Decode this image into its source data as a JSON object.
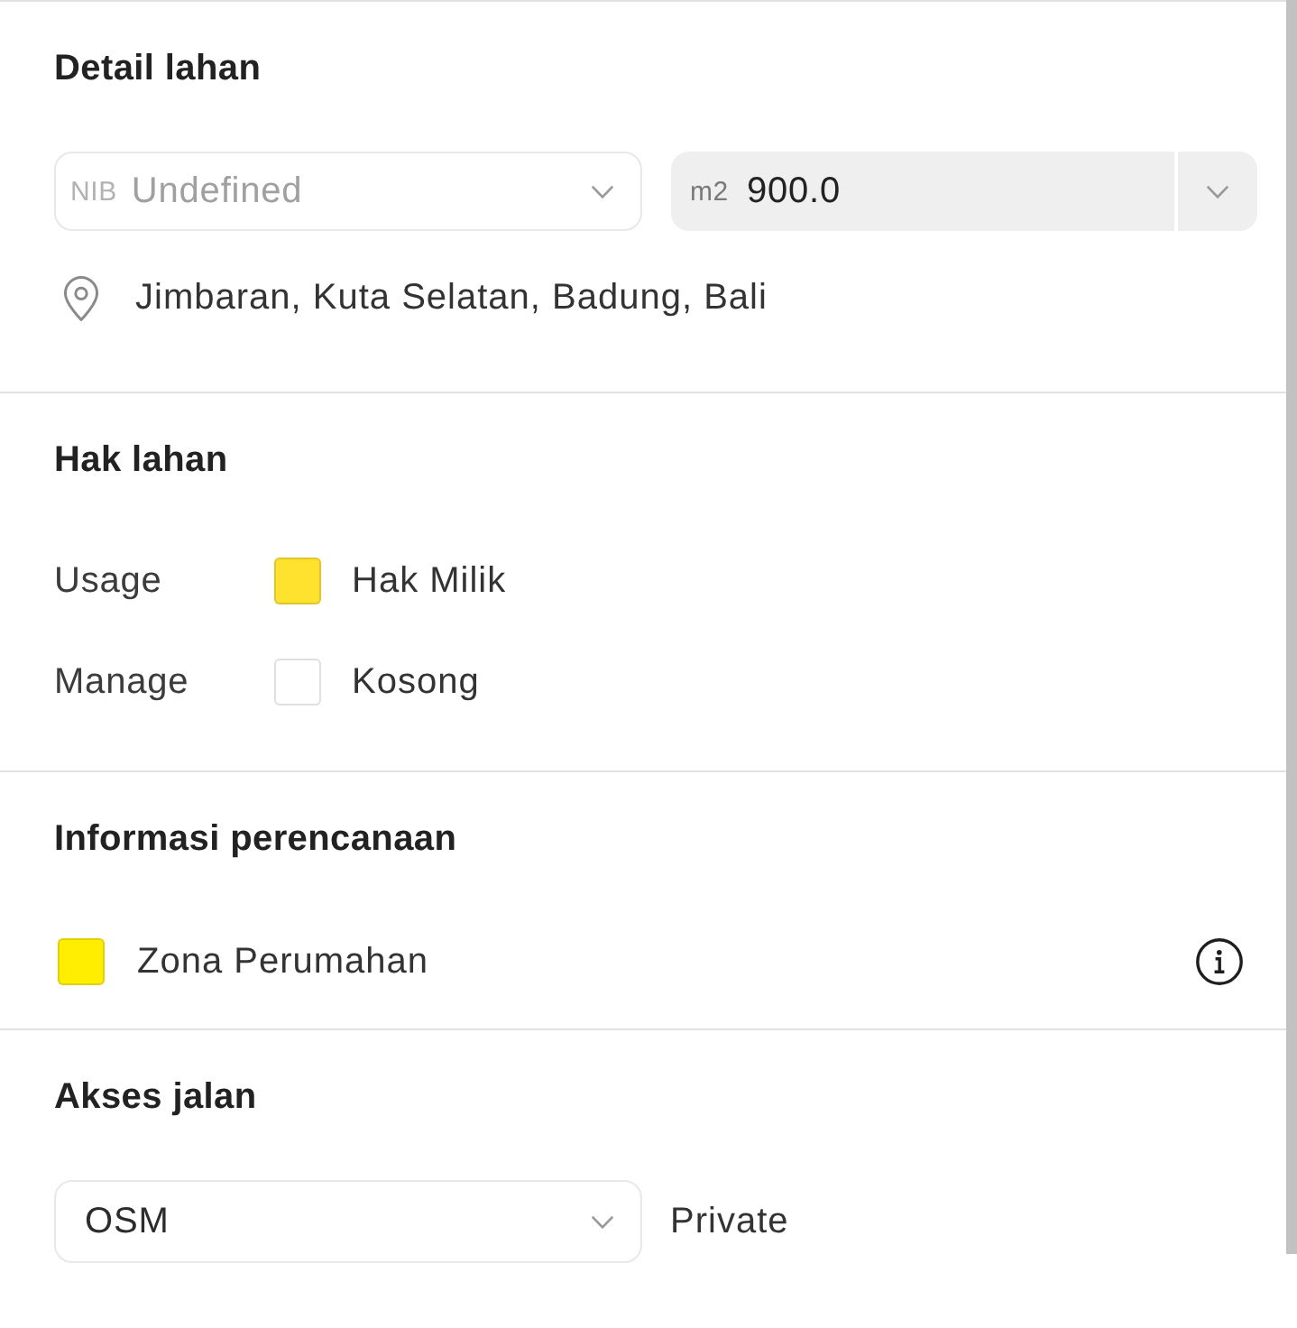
{
  "sections": [
    {
      "kind": "detail",
      "title": "Detail lahan",
      "nib_select": {
        "prefix": "NIB",
        "placeholder": "Undefined"
      },
      "area_field": {
        "unit": "m2",
        "value": "900.0"
      },
      "location": "Jimbaran, Kuta Selatan, Badung, Bali"
    },
    {
      "kind": "rights",
      "title": "Hak lahan",
      "rows": [
        {
          "label": "Usage",
          "value": "Hak Milik",
          "color": "#ffe22e"
        },
        {
          "label": "Manage",
          "value": "Kosong",
          "color": "#ffffff"
        }
      ]
    },
    {
      "kind": "planning",
      "title": "Informasi perencanaan",
      "zones": [
        {
          "name": "Zona Perumahan",
          "color": "#ffee00"
        }
      ]
    },
    {
      "kind": "road",
      "title": "Akses jalan",
      "source_select": {
        "value": "OSM"
      },
      "access": "Private"
    }
  ]
}
